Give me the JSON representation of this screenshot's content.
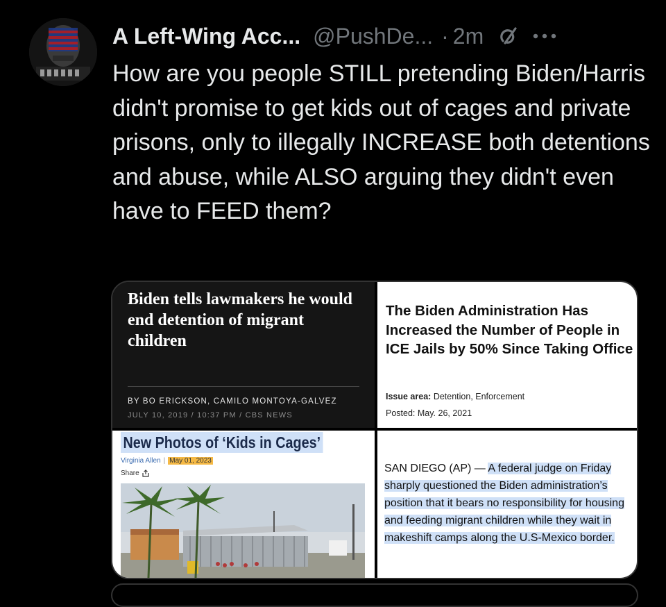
{
  "post": {
    "display_name": "A Left-Wing Acc...",
    "handle": "@PushDe...",
    "separator": "·",
    "time": "2m",
    "text": "How are you people STILL pretending Biden/Harris didn't promise to get kids out of cages and private prisons, only to illegally INCREASE both detentions and abuse, while ALSO arguing they didn't even have to FEED them?"
  },
  "media": {
    "panel1": {
      "headline": "Biden tells lawmakers he would end detention of migrant children",
      "byline": "BY BO ERICKSON, CAMILO MONTOYA-GALVEZ",
      "dateline": "JULY 10, 2019 / 10:37 PM / CBS NEWS"
    },
    "panel2": {
      "headline": "The Biden Administration Has Increased the Number of People in ICE Jails by 50% Since Taking Office",
      "issue_label": "Issue area:",
      "issue_value": "Detention, Enforcement",
      "posted": "Posted: May. 26, 2021"
    },
    "panel3": {
      "headline": "New Photos of ‘Kids in Cages’",
      "author": "Virginia Allen",
      "meta_sep": "|",
      "date": "May 01, 2023",
      "share": "Share"
    },
    "panel4": {
      "lead": "SAN DIEGO (AP) — ",
      "body": "A federal judge on Friday sharply questioned the Biden administration’s position that it bears no responsibility for housing and feeding migrant children while they wait in makeshift camps along the U.S-Mexico border."
    }
  },
  "icons": {
    "grok": "grok-icon",
    "more": "more-icon",
    "share": "share-icon"
  },
  "colors": {
    "background": "#000000",
    "text": "#e7e9ea",
    "secondary": "#71767b",
    "highlight": "#cfe0f7"
  }
}
